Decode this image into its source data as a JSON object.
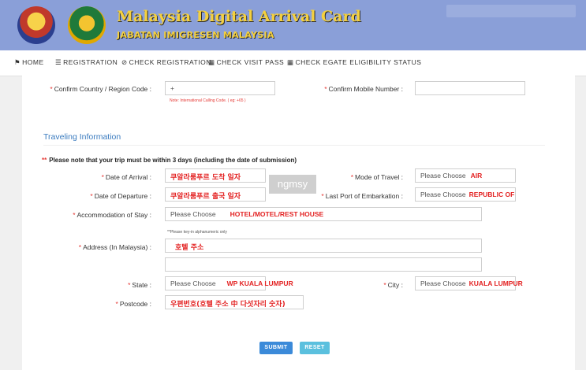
{
  "header": {
    "title": "Malaysia Digital Arrival Card",
    "subtitle": "JABATAN IMIGRESEN MALAYSIA"
  },
  "nav": [
    {
      "icon": "home-icon",
      "glyph": "⚑",
      "label": "HOME"
    },
    {
      "icon": "list-icon",
      "glyph": "☰",
      "label": "REGISTRATION"
    },
    {
      "icon": "check-circle-icon",
      "glyph": "⊘",
      "label": "CHECK REGISTRATION"
    },
    {
      "icon": "calendar-icon",
      "glyph": "▦",
      "label": "CHECK VISIT PASS"
    },
    {
      "icon": "calendar-icon",
      "glyph": "▦",
      "label": "CHECK EGATE ELIGIBILITY STATUS"
    }
  ],
  "contact": {
    "confirm_country_label": "Confirm Country / Region Code :",
    "confirm_country_value": "+",
    "calling_note": "Note: International Calling Code. ( eg: +65 )",
    "confirm_mobile_label": "Confirm Mobile Number :"
  },
  "travel": {
    "section_title": "Traveling Information",
    "warning_marker": "**",
    "warning": "Please note that your trip must be within 3 days (including the date of submission)",
    "arrival_label": "Date of Arrival :",
    "arrival_value": "쿠알라룸푸르 도착 일자",
    "departure_label": "Date of Departure :",
    "departure_value": "쿠알라룸푸르 출국 일자",
    "mode_label": "Mode of Travel :",
    "mode_placeholder": "Please Choose",
    "mode_value": "AIR",
    "port_label": "Last Port of Embarkation :",
    "port_placeholder": "Please Choose",
    "port_value": "REPUBLIC OF KOREA",
    "accommodation_label": "Accommodation of Stay :",
    "accommodation_placeholder": "Please Choose",
    "accommodation_value": "HOTEL/MOTEL/REST HOUSE",
    "address_note": "**Please key-in alphanumeric only",
    "address_label": "Address (In Malaysia) :",
    "address_value": "호텔 주소",
    "state_label": "State :",
    "state_placeholder": "Please Choose",
    "state_value": "WP KUALA LUMPUR",
    "city_label": "City :",
    "city_placeholder": "Please Choose",
    "city_value": "KUALA LUMPUR",
    "postcode_label": "Postcode :",
    "postcode_value": "우편번호(호텔 주소 中 다섯자리 숫자)"
  },
  "watermark": "ngmsy",
  "buttons": {
    "submit": "SUBMIT",
    "reset": "RESET"
  },
  "colors": {
    "header": "#8a9fd8",
    "submit": "#3b8ad9",
    "reset": "#5bc0de",
    "required": "#e53935"
  }
}
